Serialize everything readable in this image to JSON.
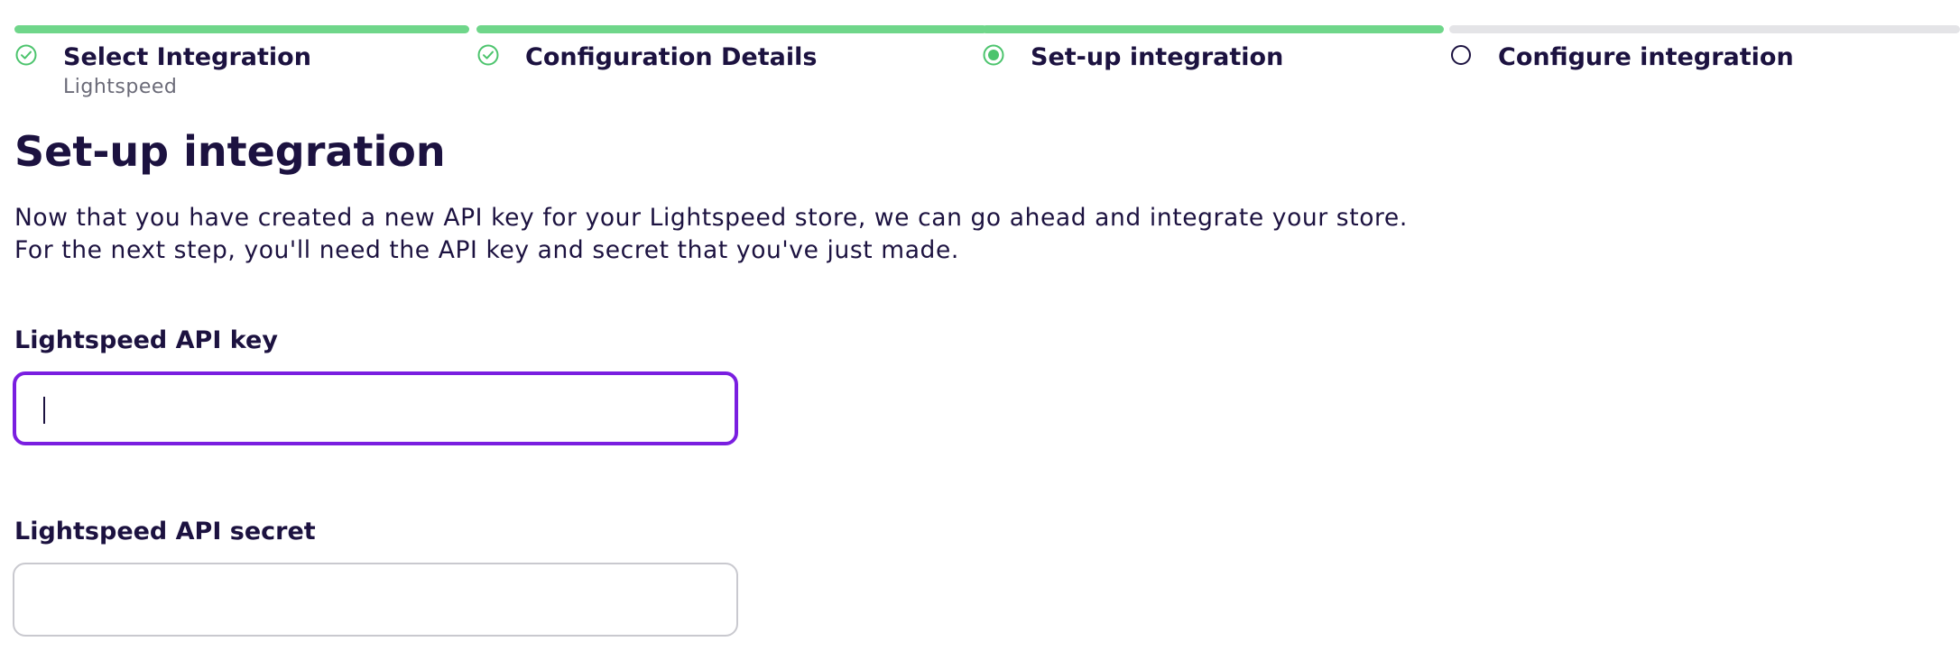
{
  "stepper": {
    "steps": [
      {
        "title": "Select Integration",
        "subtitle": "Lightspeed",
        "status": "completed",
        "icon": "check-circle-icon"
      },
      {
        "title": "Configuration Details",
        "subtitle": "",
        "status": "completed",
        "icon": "check-circle-icon"
      },
      {
        "title": "Set-up integration",
        "subtitle": "",
        "status": "current",
        "icon": "radio-current-icon"
      },
      {
        "title": "Configure integration",
        "subtitle": "",
        "status": "upcoming",
        "icon": "empty-circle-icon"
      }
    ],
    "colors": {
      "completed": "#6fd68a",
      "upcoming": "#e4e4e7"
    }
  },
  "main": {
    "title": "Set-up integration",
    "intro_line_1": "Now that you have created a new API key for your Lightspeed store, we can go ahead and integrate your store.",
    "intro_line_2": "For the next step, you'll need the API key and secret that you've just made."
  },
  "form": {
    "api_key": {
      "label": "Lightspeed API key",
      "value": "",
      "placeholder": "",
      "focused": true
    },
    "api_secret": {
      "label": "Lightspeed API secret",
      "value": "",
      "placeholder": "",
      "focused": false
    }
  },
  "colors": {
    "text": "#1c1240",
    "accent_focus": "#7a1ee0",
    "muted": "#6b6b78"
  }
}
